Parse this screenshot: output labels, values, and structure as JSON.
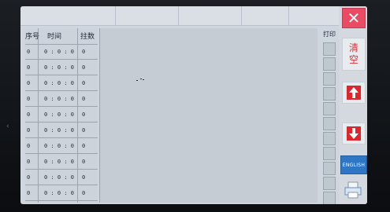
{
  "table": {
    "headers": {
      "index": "序号",
      "time": "时间",
      "count": "拄数"
    },
    "rows": [
      {
        "index": "0",
        "time": "0 : 0 : 0",
        "count": "0"
      },
      {
        "index": "0",
        "time": "0 : 0 : 0",
        "count": "0"
      },
      {
        "index": "0",
        "time": "0 : 0 : 0",
        "count": "0"
      },
      {
        "index": "0",
        "time": "0 : 0 : 0",
        "count": "0"
      },
      {
        "index": "0",
        "time": "0 : 0 : 0",
        "count": "0"
      },
      {
        "index": "0",
        "time": "0 : 0 : 0",
        "count": "0"
      },
      {
        "index": "0",
        "time": "0 : 0 : 0",
        "count": "0"
      },
      {
        "index": "0",
        "time": "0 : 0 : 0",
        "count": "0"
      },
      {
        "index": "0",
        "time": "0 : 0 : 0",
        "count": "0"
      },
      {
        "index": "0",
        "time": "0 : 0 : 0",
        "count": "0"
      }
    ]
  },
  "print_column": {
    "label": "打印",
    "boxes": 11
  },
  "sidebar": {
    "close_symbol": "✕",
    "clear_label": "清\n空",
    "english_label": "ENGLISH"
  },
  "icons": {
    "close": "close-icon",
    "up": "arrow-up-icon",
    "down": "arrow-down-icon",
    "printer": "printer-icon"
  },
  "colors": {
    "close_bg": "#e94b63",
    "arrow_red": "#e0262d",
    "english_bg": "#2f76c4",
    "clear_text": "#e0303a",
    "screen_bg": "#cfd6de"
  }
}
